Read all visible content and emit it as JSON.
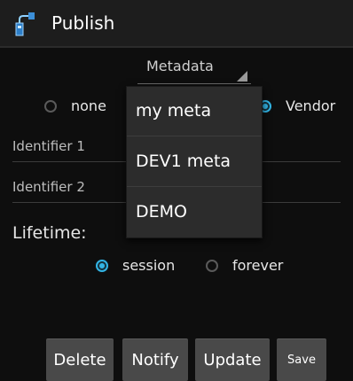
{
  "action_bar": {
    "title": "Publish",
    "icon": "usb-plug-icon"
  },
  "spinner": {
    "label": "Metadata"
  },
  "scope": {
    "options": [
      {
        "label": "none",
        "checked": false
      },
      {
        "label": "Vendor",
        "checked": true
      }
    ]
  },
  "fields": {
    "identifier1_hint": "Identifier 1",
    "identifier2_hint": "Identifier 2"
  },
  "lifetime": {
    "label": "Lifetime:",
    "options": [
      {
        "label": "session",
        "checked": true
      },
      {
        "label": "forever",
        "checked": false
      }
    ]
  },
  "buttons": {
    "delete": "Delete",
    "notify": "Notify",
    "update": "Update",
    "save": "Save"
  },
  "popup": {
    "items": [
      "my meta",
      "DEV1 meta",
      "DEMO"
    ]
  },
  "colors": {
    "accent": "#33b5e5",
    "background": "#0e0e0e",
    "button": "#494949",
    "popup": "#2c2c2c"
  }
}
